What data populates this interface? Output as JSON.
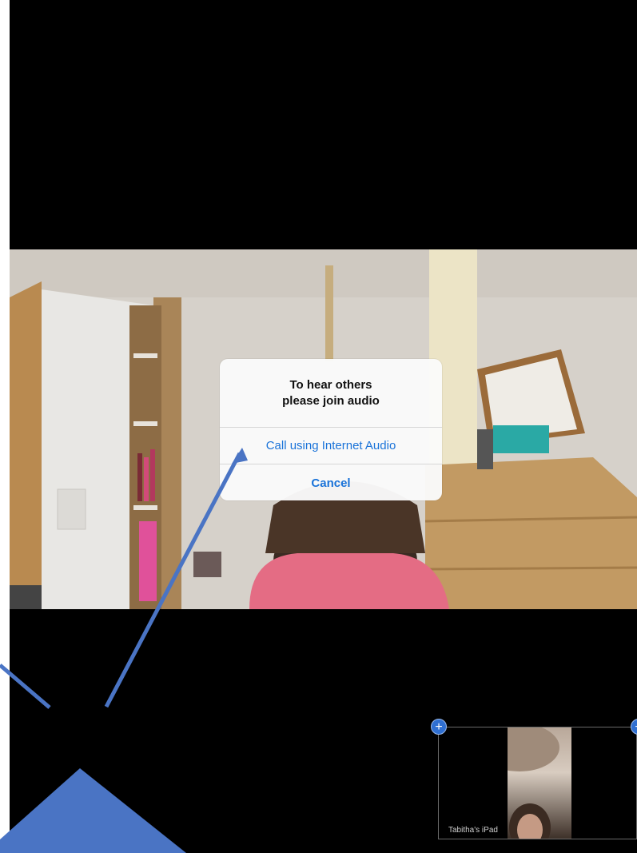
{
  "dialog": {
    "title_line1": "To hear others",
    "title_line2": "please join audio",
    "primary_option": "Call using Internet Audio",
    "cancel": "Cancel"
  },
  "self_view": {
    "label": "Tabitha's iPad",
    "add_icon": "plus-icon"
  },
  "annotation": {
    "arrow_icon": "arrow-icon",
    "color": "#4a74c4"
  },
  "colors": {
    "background": "#000000",
    "link_blue": "#1a73d9",
    "plus_blue": "#2f6fd1"
  }
}
